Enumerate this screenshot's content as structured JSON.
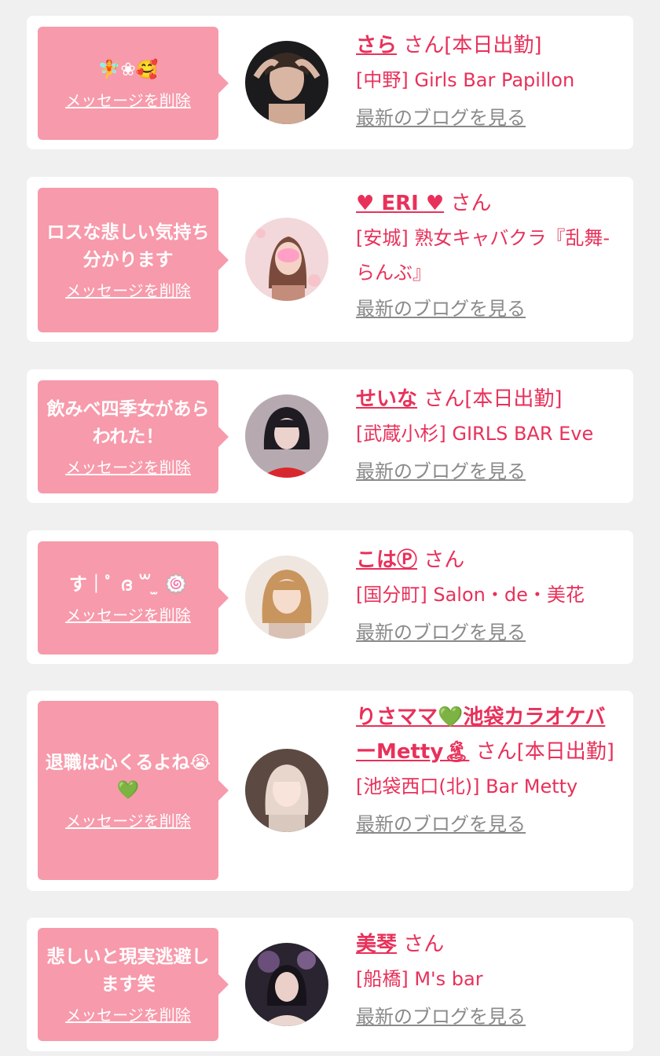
{
  "common": {
    "delete_label": "メッセージを削除",
    "blog_label": "最新のブログを見る"
  },
  "colors": {
    "background": "#f0f0f0",
    "bubble": "#f79aab",
    "accent": "#e8315a",
    "link_gray": "#8a8a8a"
  },
  "cards": [
    {
      "message": "🧚❀🥰",
      "name": "さら",
      "suffix": "さん[本日出勤]",
      "shop": "[中野] Girls Bar Papillon"
    },
    {
      "message": "ロスな悲しい気持ち分かります",
      "name": "♥ ERI ♥",
      "suffix": "さん",
      "shop": "[安城] 熟女キャバクラ『乱舞-らんぶ』"
    },
    {
      "message": "飲みべ四季女があらわれた！",
      "name": "せいな",
      "suffix": "さん[本日出勤]",
      "shop": "[武蔵小杉] GIRLS BAR Eve"
    },
    {
      "message": "す｜ﾟ ദ ꒳ ̫ 🍥",
      "name": "こはⓅ",
      "suffix": "さん",
      "shop": "[国分町] Salon・de・美花"
    },
    {
      "message": "退職は心くるよね😭💚",
      "name": "りさママ💚池袋カラオケバーMetty🏝",
      "suffix": "さん[本日出勤]",
      "shop": "[池袋西口(北)] Bar Metty"
    },
    {
      "message": "悲しいと現実逃避します笑",
      "name": "美琴",
      "suffix": "さん",
      "shop": "[船橋] M's bar"
    }
  ]
}
